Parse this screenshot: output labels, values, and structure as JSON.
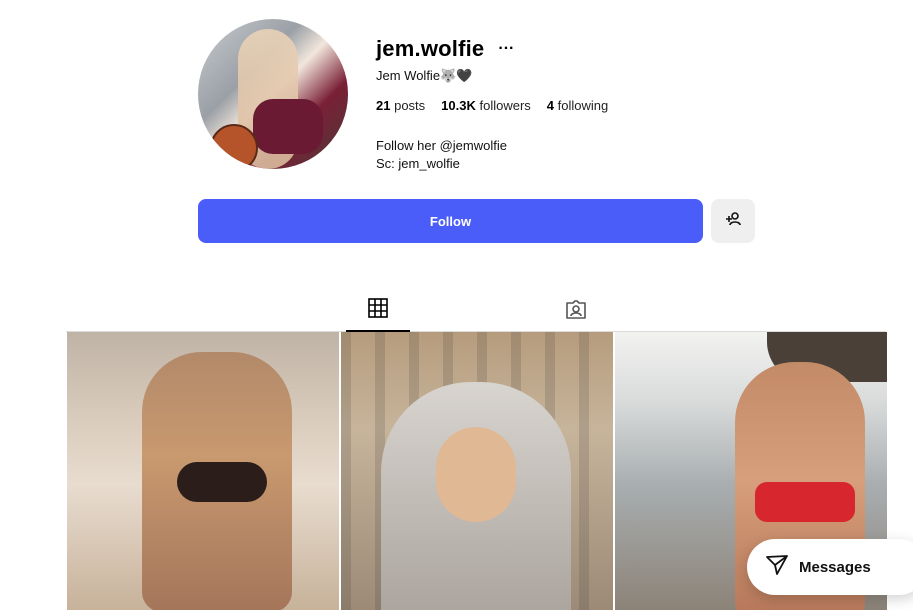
{
  "profile": {
    "username": "jem.wolfie",
    "more_icon": "···",
    "display_name": "Jem Wolfie🐺🖤",
    "stats": {
      "posts_count": "21",
      "posts_label": "posts",
      "followers_count": "10.3K",
      "followers_label": "followers",
      "following_count": "4",
      "following_label": "following"
    },
    "bio": {
      "line1": "Follow her @jemwolfie",
      "line2": "Sc: jem_wolfie"
    }
  },
  "actions": {
    "follow_label": "Follow",
    "suggest_icon": "add-person-icon"
  },
  "tabs": [
    {
      "icon": "grid-icon",
      "active": true
    },
    {
      "icon": "tagged-icon",
      "active": false
    }
  ],
  "messages": {
    "label": "Messages",
    "icon": "send-icon"
  },
  "colors": {
    "accent": "#4a5df9",
    "secondary_button": "#efefef",
    "text": "#000000"
  }
}
